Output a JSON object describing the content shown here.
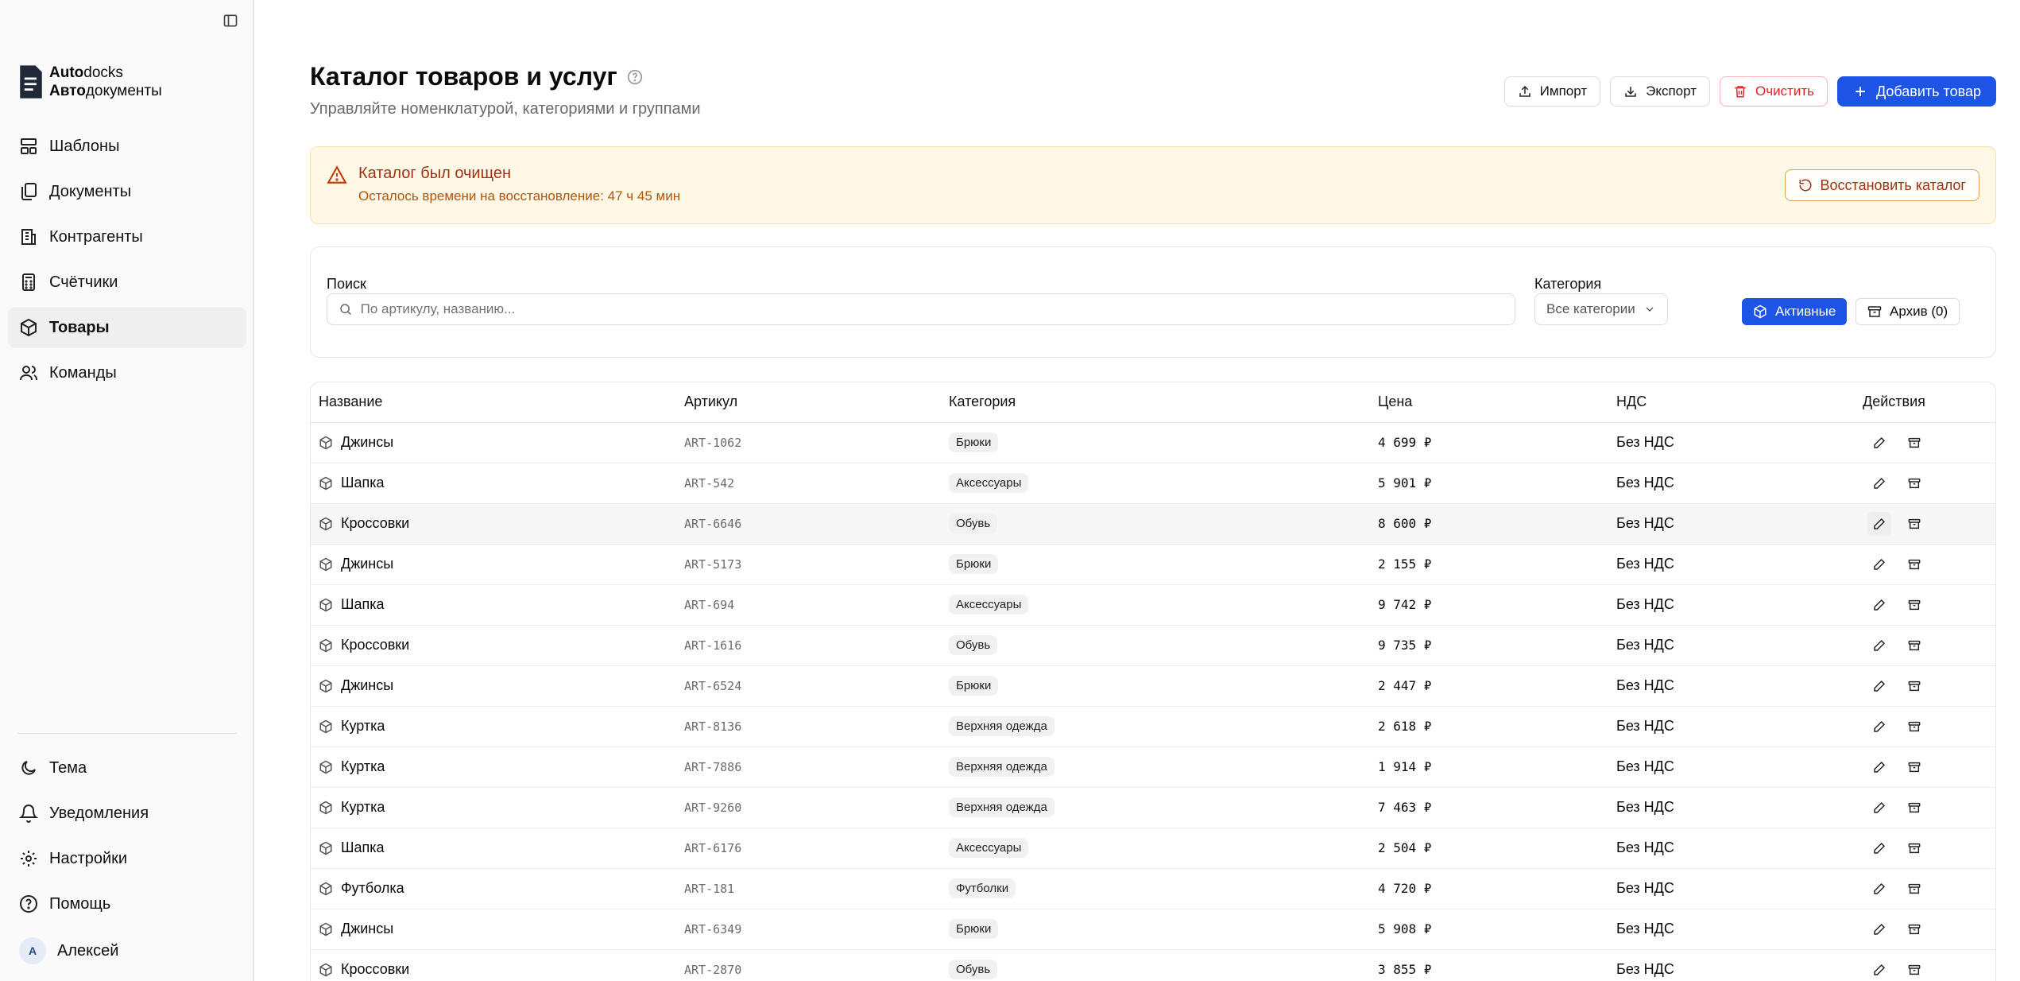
{
  "sidebar": {
    "logo": {
      "line1_bold": "Auto",
      "line1_rest": "docks",
      "line2_bold": "Авто",
      "line2_rest": "документы"
    },
    "items": [
      {
        "label": "Шаблоны",
        "icon": "templates-icon"
      },
      {
        "label": "Документы",
        "icon": "documents-icon"
      },
      {
        "label": "Контрагенты",
        "icon": "building-icon"
      },
      {
        "label": "Счётчики",
        "icon": "calculator-icon"
      },
      {
        "label": "Товары",
        "icon": "package-icon",
        "active": true
      },
      {
        "label": "Команды",
        "icon": "users-icon"
      }
    ],
    "bottom": [
      {
        "label": "Тема",
        "icon": "moon-icon"
      },
      {
        "label": "Уведомления",
        "icon": "bell-icon"
      },
      {
        "label": "Настройки",
        "icon": "gear-icon"
      },
      {
        "label": "Помощь",
        "icon": "help-icon"
      }
    ],
    "user": {
      "initial": "А",
      "name": "Алексей"
    }
  },
  "header": {
    "title": "Каталог товаров и услуг",
    "subtitle": "Управляйте номенклатурой, категориями и группами",
    "import_label": "Импорт",
    "export_label": "Экспорт",
    "clear_label": "Очистить",
    "add_label": "Добавить товар"
  },
  "alert": {
    "title": "Каталог был очищен",
    "text": "Осталось времени на восстановление: 47 ч 45 мин",
    "restore_label": "Восстановить каталог"
  },
  "filters": {
    "search_label": "Поиск",
    "search_placeholder": "По артикулу, названию...",
    "category_label": "Категория",
    "category_value": "Все категории",
    "active_label": "Активные",
    "archive_label": "Архив (0)"
  },
  "table": {
    "columns": [
      "Название",
      "Артикул",
      "Категория",
      "Цена",
      "НДС",
      "Действия"
    ],
    "rows": [
      {
        "name": "Джинсы",
        "sku": "ART-1062",
        "category": "Брюки",
        "price": "4 699 ₽",
        "vat": "Без НДС"
      },
      {
        "name": "Шапка",
        "sku": "ART-542",
        "category": "Аксессуары",
        "price": "5 901 ₽",
        "vat": "Без НДС"
      },
      {
        "name": "Кроссовки",
        "sku": "ART-6646",
        "category": "Обувь",
        "price": "8 600 ₽",
        "vat": "Без НДС"
      },
      {
        "name": "Джинсы",
        "sku": "ART-5173",
        "category": "Брюки",
        "price": "2 155 ₽",
        "vat": "Без НДС"
      },
      {
        "name": "Шапка",
        "sku": "ART-694",
        "category": "Аксессуары",
        "price": "9 742 ₽",
        "vat": "Без НДС"
      },
      {
        "name": "Кроссовки",
        "sku": "ART-1616",
        "category": "Обувь",
        "price": "9 735 ₽",
        "vat": "Без НДС"
      },
      {
        "name": "Джинсы",
        "sku": "ART-6524",
        "category": "Брюки",
        "price": "2 447 ₽",
        "vat": "Без НДС"
      },
      {
        "name": "Куртка",
        "sku": "ART-8136",
        "category": "Верхняя одежда",
        "price": "2 618 ₽",
        "vat": "Без НДС"
      },
      {
        "name": "Куртка",
        "sku": "ART-7886",
        "category": "Верхняя одежда",
        "price": "1 914 ₽",
        "vat": "Без НДС"
      },
      {
        "name": "Куртка",
        "sku": "ART-9260",
        "category": "Верхняя одежда",
        "price": "7 463 ₽",
        "vat": "Без НДС"
      },
      {
        "name": "Шапка",
        "sku": "ART-6176",
        "category": "Аксессуары",
        "price": "2 504 ₽",
        "vat": "Без НДС"
      },
      {
        "name": "Футболка",
        "sku": "ART-181",
        "category": "Футболки",
        "price": "4 720 ₽",
        "vat": "Без НДС"
      },
      {
        "name": "Джинсы",
        "sku": "ART-6349",
        "category": "Брюки",
        "price": "5 908 ₽",
        "vat": "Без НДС"
      },
      {
        "name": "Кроссовки",
        "sku": "ART-2870",
        "category": "Обувь",
        "price": "3 855 ₽",
        "vat": "Без НДС"
      }
    ]
  },
  "colors": {
    "primary": "#1e54e6",
    "danger": "#dc2626",
    "alert_bg": "#fff8e6",
    "alert_text": "#9a3412"
  }
}
